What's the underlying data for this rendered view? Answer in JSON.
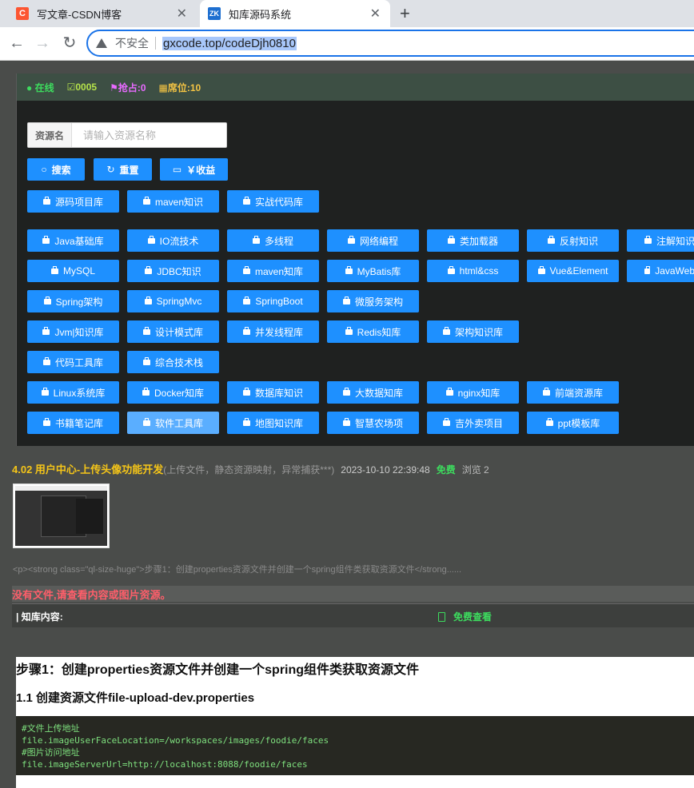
{
  "browser": {
    "tabs": [
      {
        "title": "写文章-CSDN博客",
        "favicon": "C"
      },
      {
        "title": "知库源码系统",
        "favicon": "ZK"
      }
    ],
    "security_label": "不安全",
    "url": "gxcode.top/codeDjh0810"
  },
  "status": {
    "online": "在线",
    "count": "0005",
    "grab": "抢占:0",
    "slots": "席位:10"
  },
  "search": {
    "label": "资源名",
    "placeholder": "请输入资源名称"
  },
  "actions": {
    "search": "搜索",
    "reset": "重置",
    "earnings": "￥收益"
  },
  "categories_top": [
    "源码项目库",
    "maven知识",
    "实战代码库"
  ],
  "categories": [
    [
      "Java基础库",
      "IO流技术",
      "多线程",
      "网络编程",
      "类加载器",
      "反射知识",
      "注解知识"
    ],
    [
      "MySQL",
      "JDBC知识",
      "maven知库",
      "MyBatis库",
      "html&css",
      "Vue&Element",
      "JavaWeb"
    ],
    [
      "Spring架构",
      "SpringMvc",
      "SpringBoot",
      "微服务架构"
    ],
    [
      "Jvm|知识库",
      "设计模式库",
      "并发线程库",
      "Redis知库",
      "架构知识库"
    ],
    [
      "代码工具库",
      "综合技术栈"
    ],
    [
      "Linux系统库",
      "Docker知库",
      "数据库知识",
      "大数据知库",
      "nginx知库",
      "前端资源库"
    ],
    [
      "书籍笔记库",
      "软件工具库",
      "地图知识库",
      "智慧农场项",
      "吉外卖项目",
      "ppt模板库"
    ]
  ],
  "article": {
    "title": "4.02 用户中心-上传头像功能开发",
    "subtitle": "(上传文件，静态资源映射，异常捕获***)",
    "date": "2023-10-10 22:39:48",
    "price": "免费",
    "views": "浏览 2",
    "excerpt": "<p><strong class=\"ql-size-huge\">步骤1：创建properties资源文件并创建一个spring组件类获取资源文件</strong......",
    "no_file_notice": "没有文件,请查看内容或图片资源。",
    "content_label": "| 知库内容:",
    "free_view": "免费查看"
  },
  "doc": {
    "heading1": "步骤1：创建properties资源文件并创建一个spring组件类获取资源文件",
    "heading2": "1.1 创建资源文件file-upload-dev.properties",
    "code_lines": [
      "#文件上传地址",
      "file.imageUserFaceLocation=/workspaces/images/foodie/faces",
      "#图片访问地址",
      "file.imageServerUrl=http://localhost:8088/foodie/faces"
    ]
  }
}
